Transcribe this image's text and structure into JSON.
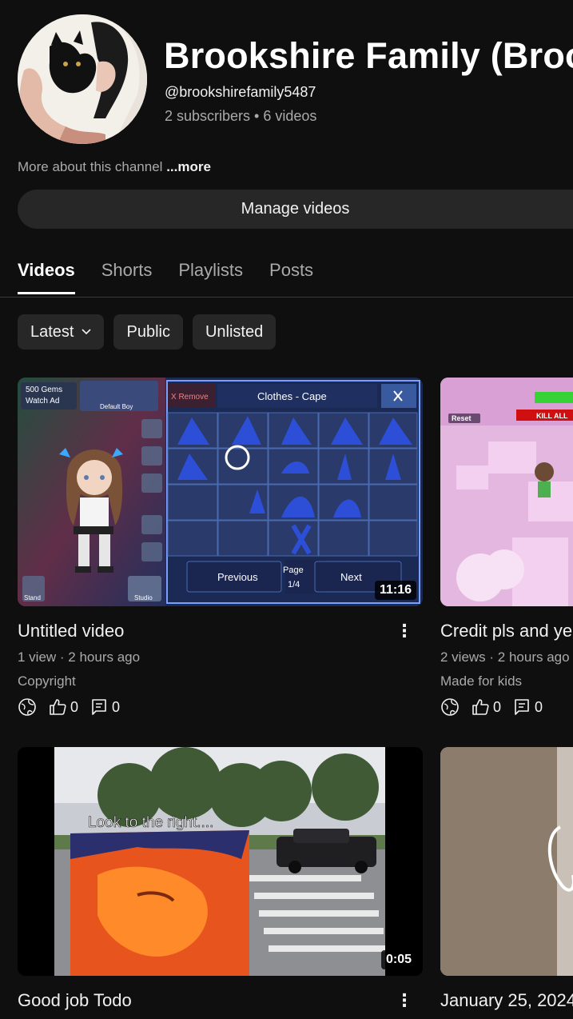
{
  "channel": {
    "name": "Brookshire Family (Brookshire Family)",
    "handle": "@brookshirefamily5487",
    "stats": "2 subscribers • 6 videos",
    "about_text": "More about this channel",
    "about_more": "...more",
    "manage_button": "Manage videos"
  },
  "tabs": [
    {
      "label": "Videos",
      "active": true
    },
    {
      "label": "Shorts",
      "active": false
    },
    {
      "label": "Playlists",
      "active": false
    },
    {
      "label": "Posts",
      "active": false
    }
  ],
  "chips": {
    "sort_label": "Latest",
    "public_label": "Public",
    "unlisted_label": "Unlisted"
  },
  "videos": [
    {
      "title": "Untitled video",
      "meta": "1 view · 2 hours ago",
      "note": "Copyright",
      "duration": "11:16",
      "likes": "0",
      "comments": "0",
      "thumb_text": {
        "gems": "500 Gems",
        "watch_ad": "Watch Ad",
        "default_boy": "Default Boy",
        "remove": "X Remove",
        "clothes": "Clothes - Cape",
        "page": "Page",
        "page_num": "1/4",
        "previous": "Previous",
        "next": "Next",
        "stand": "Stand",
        "studio": "Studio"
      }
    },
    {
      "title": "Credit pls and yes",
      "meta": "2 views · 2 hours ago",
      "note": "Made for kids",
      "likes": "0",
      "comments": "0",
      "thumb_text": {
        "reset": "Reset",
        "kill": "KILL ALL"
      }
    },
    {
      "title": "Good job Todo",
      "duration": "0:05",
      "thumb_text": {
        "caption": "Look to the right...."
      }
    },
    {
      "title": "January 25, 2024"
    }
  ]
}
